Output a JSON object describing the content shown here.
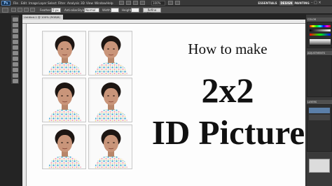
{
  "app": {
    "logo": "Ps",
    "menu": [
      "File",
      "Edit",
      "Image",
      "Layer",
      "Select",
      "Filter",
      "Analysis",
      "3D",
      "View",
      "Window",
      "Help"
    ],
    "zoom": "100%",
    "workspaces": [
      "ESSENTIALS",
      "DESIGN",
      "PAINTING"
    ],
    "window_controls": "– □ ×"
  },
  "options": {
    "feather_label": "Feather:",
    "feather_value": "0 px",
    "antialias_label": "Anti-alias",
    "style_label": "Style:",
    "style_value": "Normal",
    "width_label": "Width:",
    "height_label": "Height:",
    "refine_label": "Refine Edge..."
  },
  "document": {
    "tab_label": "Untitled-1 @ 100% (RGB/8)"
  },
  "poster": {
    "line1": "How to make",
    "line2": "2x2",
    "line3": "ID Picture"
  },
  "panels": {
    "color": "COLOR",
    "adjustments": "ADJUSTMENTS",
    "layers": "LAYERS"
  },
  "colors": {
    "shirt_pattern": [
      "#49a8d6",
      "#f3a3b8",
      "#7cc88a",
      "#f2d060"
    ]
  }
}
